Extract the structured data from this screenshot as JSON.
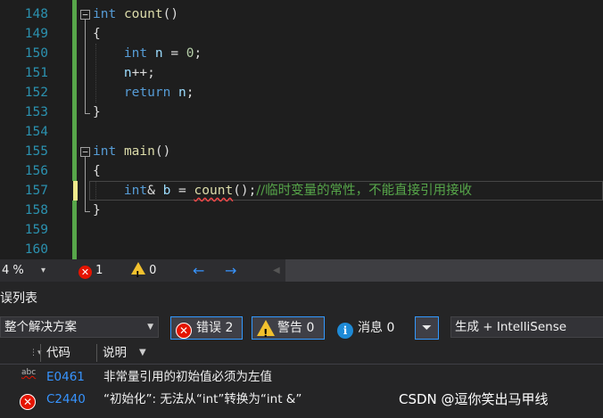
{
  "editor": {
    "line_numbers": [
      "148",
      "149",
      "150",
      "151",
      "152",
      "153",
      "154",
      "155",
      "156",
      "157",
      "158",
      "159",
      "160"
    ],
    "lines": {
      "l148_kw": "int",
      "l148_fn": "count",
      "l148_rest": "()",
      "l149": "{",
      "l150_kw": "int",
      "l150_var": "n",
      "l150_op": " = ",
      "l150_num": "0",
      "l150_end": ";",
      "l151_var": "n",
      "l151_rest": "++;",
      "l152_kw": "return",
      "l152_var": "n",
      "l152_end": ";",
      "l153": "}",
      "l155_kw": "int",
      "l155_fn": "main",
      "l155_rest": "()",
      "l156": "{",
      "l157_kw": "int",
      "l157_amp": "& ",
      "l157_var": "b",
      "l157_op": " = ",
      "l157_fn": "count",
      "l157_rest": "();",
      "l157_comment": "//临时变量的常性，不能直接引用接收",
      "l158": "}"
    }
  },
  "edit_status": {
    "zoom": "4 %",
    "zoom_arrow": "▾",
    "errors": "1",
    "warnings": "0",
    "back_arrow": "←",
    "fwd_arrow": "→",
    "scroll_left": "◀"
  },
  "error_list": {
    "title": "误列表",
    "scope": "整个解决方案",
    "errors_label": "错误 2",
    "warnings_label": "警告 0",
    "messages_label": "消息 0",
    "build_source": "生成 + IntelliSense",
    "columns": {
      "code": "代码",
      "desc": "说明"
    },
    "rows": [
      {
        "icon": "abc",
        "code": "E0461",
        "desc": "非常量引用的初始值必须为左值"
      },
      {
        "icon": "error",
        "code": "C2440",
        "desc": "“初始化”: 无法从“int”转换为“int &”"
      }
    ],
    "watermark": "CSDN @逗你笑出马甲线"
  }
}
